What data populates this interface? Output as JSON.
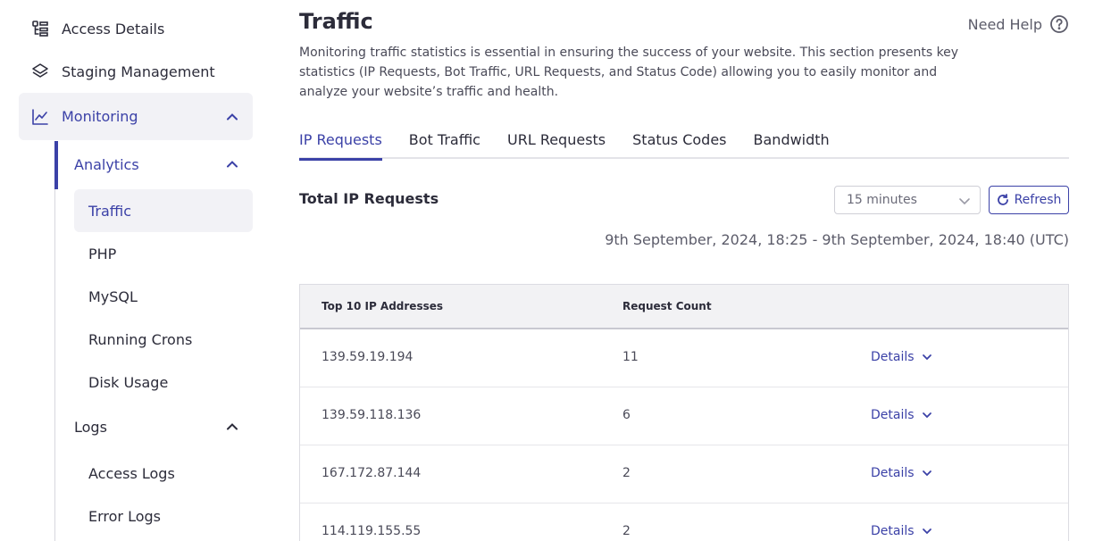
{
  "sidebar": {
    "access_details": "Access Details",
    "staging_management": "Staging Management",
    "monitoring": "Monitoring",
    "analytics": "Analytics",
    "analytics_items": [
      "Traffic",
      "PHP",
      "MySQL",
      "Running Crons",
      "Disk Usage"
    ],
    "logs": "Logs",
    "logs_items": [
      "Access Logs",
      "Error Logs"
    ]
  },
  "header": {
    "title": "Traffic",
    "help_label": "Need Help",
    "description": "Monitoring traffic statistics is essential in ensuring the success of your website. This section presents key statistics (IP Requests, Bot Traffic, URL Requests, and Status Code) allowing you to easily monitor and analyze your website’s traffic and health."
  },
  "tabs": [
    "IP Requests",
    "Bot Traffic",
    "URL Requests",
    "Status Codes",
    "Bandwidth"
  ],
  "section": {
    "title": "Total IP Requests",
    "interval_selected": "15 minutes",
    "refresh_label": "Refresh",
    "range": "9th September, 2024, 18:25 - 9th September, 2024, 18:40 (UTC)"
  },
  "table": {
    "headers": [
      "Top 10 IP Addresses",
      "Request Count"
    ],
    "details_label": "Details",
    "rows": [
      {
        "ip": "139.59.19.194",
        "count": "11"
      },
      {
        "ip": "139.59.118.136",
        "count": "6"
      },
      {
        "ip": "167.172.87.144",
        "count": "2"
      },
      {
        "ip": "114.119.155.55",
        "count": "2"
      }
    ]
  },
  "colors": {
    "accent": "#3b41a7",
    "active_bg": "#f2f2f6",
    "header_bg": "#f2f2f4"
  },
  "icons": {
    "access_details": "list-icon",
    "staging_management": "layers-icon",
    "monitoring": "line-chart-icon",
    "help": "question-circle-icon",
    "refresh": "refresh-icon"
  }
}
